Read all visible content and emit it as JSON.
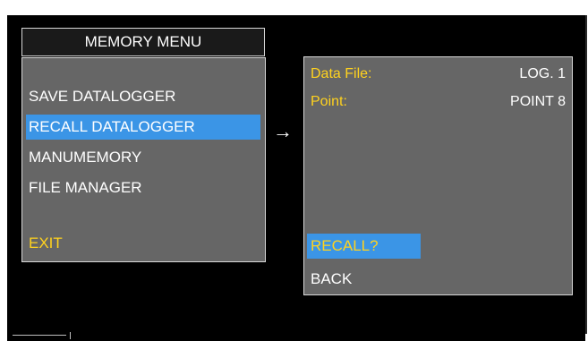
{
  "memory_menu": {
    "title": "MEMORY MENU",
    "items": [
      {
        "label": "SAVE DATALOGGER",
        "selected": false
      },
      {
        "label": "RECALL DATALOGGER",
        "selected": true
      },
      {
        "label": "MANUMEMORY",
        "selected": false
      },
      {
        "label": "FILE MANAGER",
        "selected": false
      }
    ],
    "exit_label": "EXIT"
  },
  "arrow_glyph": "→",
  "detail": {
    "data_file_label": "Data File:",
    "data_file_value": "LOG. 1",
    "point_label": "Point:",
    "point_value": "POINT 8",
    "recall_label": "RECALL?",
    "back_label": "BACK"
  },
  "colors": {
    "panel_gray": "#666666",
    "highlight_blue": "#3b95e6",
    "accent_yellow": "#ffd21e",
    "screen_black": "#000000"
  }
}
